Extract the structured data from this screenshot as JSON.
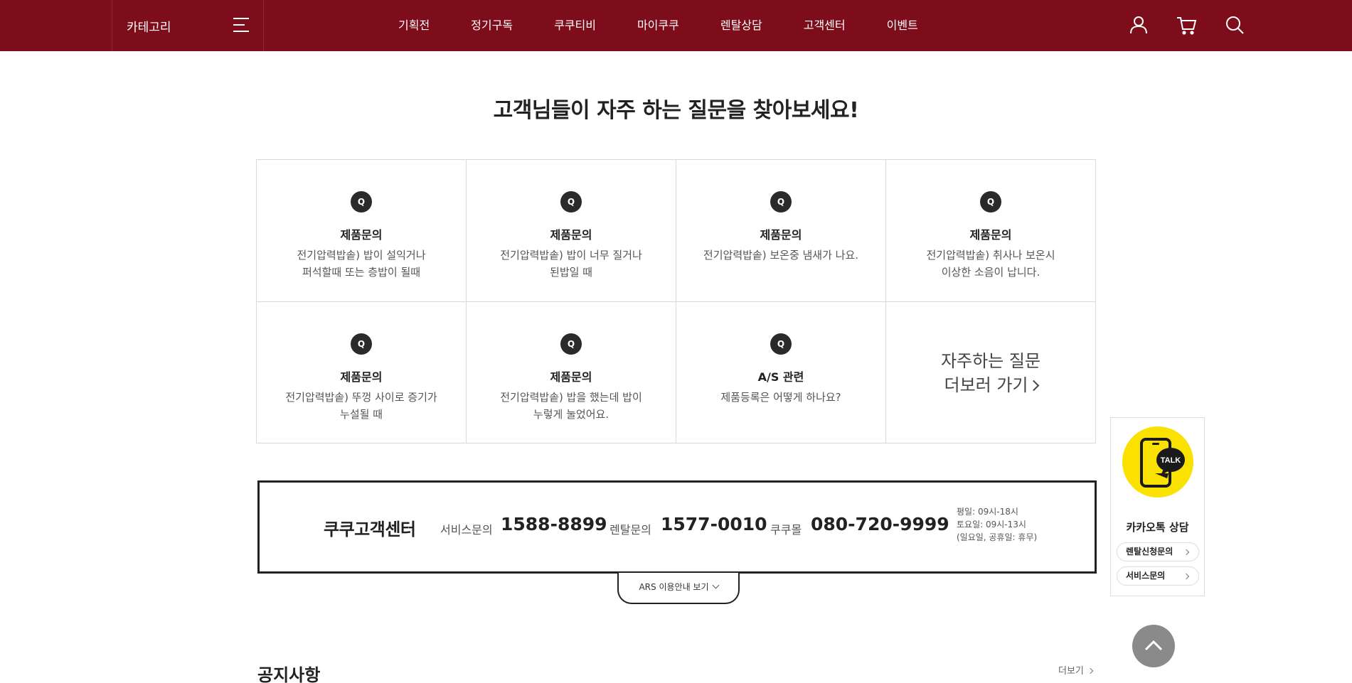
{
  "header": {
    "category_label": "카테고리",
    "nav": [
      {
        "label": "기획전"
      },
      {
        "label": "정기구독"
      },
      {
        "label": "쿠쿠티비"
      },
      {
        "label": "마이쿠쿠"
      },
      {
        "label": "렌탈상담"
      },
      {
        "label": "고객센터"
      },
      {
        "label": "이벤트"
      }
    ],
    "icons": [
      "user-icon",
      "cart-icon",
      "search-icon"
    ],
    "bg_color": "#7d0d1b"
  },
  "faq": {
    "title": "고객님들이 자주 하는 질문을 찾아보세요!",
    "badge": "Q",
    "items": [
      {
        "category": "제품문의",
        "question": "전기압력밥솥) 밥이 설익거나\n퍼석할때 또는 층밥이 될때"
      },
      {
        "category": "제품문의",
        "question": "전기압력밥솥) 밥이 너무 질거나\n된밥일 때"
      },
      {
        "category": "제품문의",
        "question": "전기압력밥솥) 보온중 냄새가 나요."
      },
      {
        "category": "제품문의",
        "question": "전기압력밥솥) 취사나 보온시\n이상한 소음이 납니다."
      },
      {
        "category": "제품문의",
        "question": "전기압력밥솥) 뚜껑 사이로 증기가\n누설될 때"
      },
      {
        "category": "제품문의",
        "question": "전기압력밥솥) 밥을 했는데 밥이\n누렇게 눌었어요."
      },
      {
        "category": "A/S 관련",
        "question": "제품등록은 어떻게 하나요?"
      }
    ],
    "more_line1": "자주하는 질문",
    "more_line2": "더보러 가기"
  },
  "customer_center": {
    "name": "쿠쿠고객센터",
    "service_label": "서비스문의",
    "service_number": "1588-8899",
    "rental_label": "렌탈문의",
    "rental_number": "1577-0010",
    "mall_label": "쿠쿠몰",
    "mall_number": "080-720-9999",
    "hours_weekday": "평일: 09시-18시",
    "hours_saturday": "토요일: 09시-13시",
    "hours_holiday": "(일요일, 공휴일: 휴무)",
    "ars_label": "ARS 이용안내 보기"
  },
  "notice": {
    "title": "공지사항",
    "more_label": "더보기"
  },
  "kakao": {
    "bubble_text": "TALK",
    "title": "카카오톡 상담",
    "rental_btn": "렌탈신청문의",
    "service_btn": "서비스문의",
    "color": "#fae100"
  }
}
